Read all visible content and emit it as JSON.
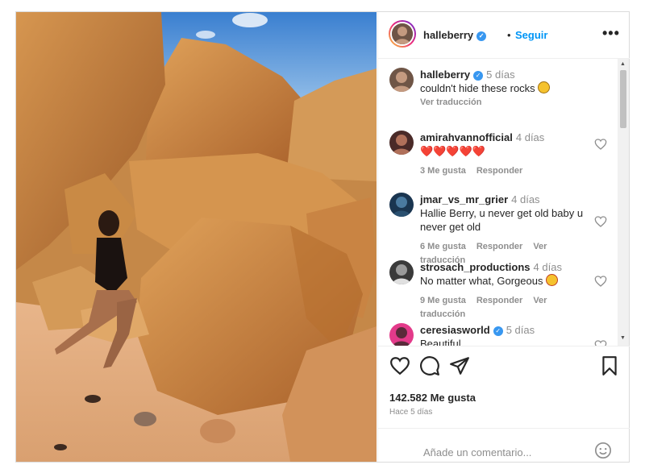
{
  "header": {
    "username": "halleberry",
    "separator": "•",
    "follow_label": "Seguir",
    "more_label": "•••"
  },
  "comments": [
    {
      "user": "halleberry",
      "time": "5 días",
      "text": "couldn't hide these rocks",
      "meta": [
        "Ver traducción"
      ],
      "verified": true
    },
    {
      "user": "amirahvannofficial",
      "time": "4 días",
      "text": "❤️❤️❤️❤️❤️",
      "meta": [
        "3 Me gusta",
        "Responder"
      ],
      "verified": false
    },
    {
      "user": "jmar_vs_mr_grier",
      "time": "4 días",
      "text": "Hallie Berry, u never get old baby u never get old",
      "meta": [
        "6 Me gusta",
        "Responder",
        "Ver traducción"
      ],
      "verified": false
    },
    {
      "user": "strosach_productions",
      "time": "4 días",
      "text": "No matter what, Gorgeous",
      "meta": [
        "9 Me gusta",
        "Responder",
        "Ver traducción"
      ],
      "verified": false
    },
    {
      "user": "ceresiasworld",
      "time": "5 días",
      "text": "Beautiful",
      "meta": [],
      "verified": true
    }
  ],
  "actions": {
    "likes": "142.582 Me gusta",
    "ago": "Hace 5 días",
    "comment_placeholder": "Añade un comentario..."
  },
  "icons": [
    "heart-icon",
    "comment-icon",
    "share-icon",
    "bookmark-icon",
    "emoji-icon",
    "more-icon",
    "verified-icon"
  ],
  "colors": {
    "accent": "#0095f6",
    "verified": "#3897f0",
    "heart": "#e0245e"
  }
}
